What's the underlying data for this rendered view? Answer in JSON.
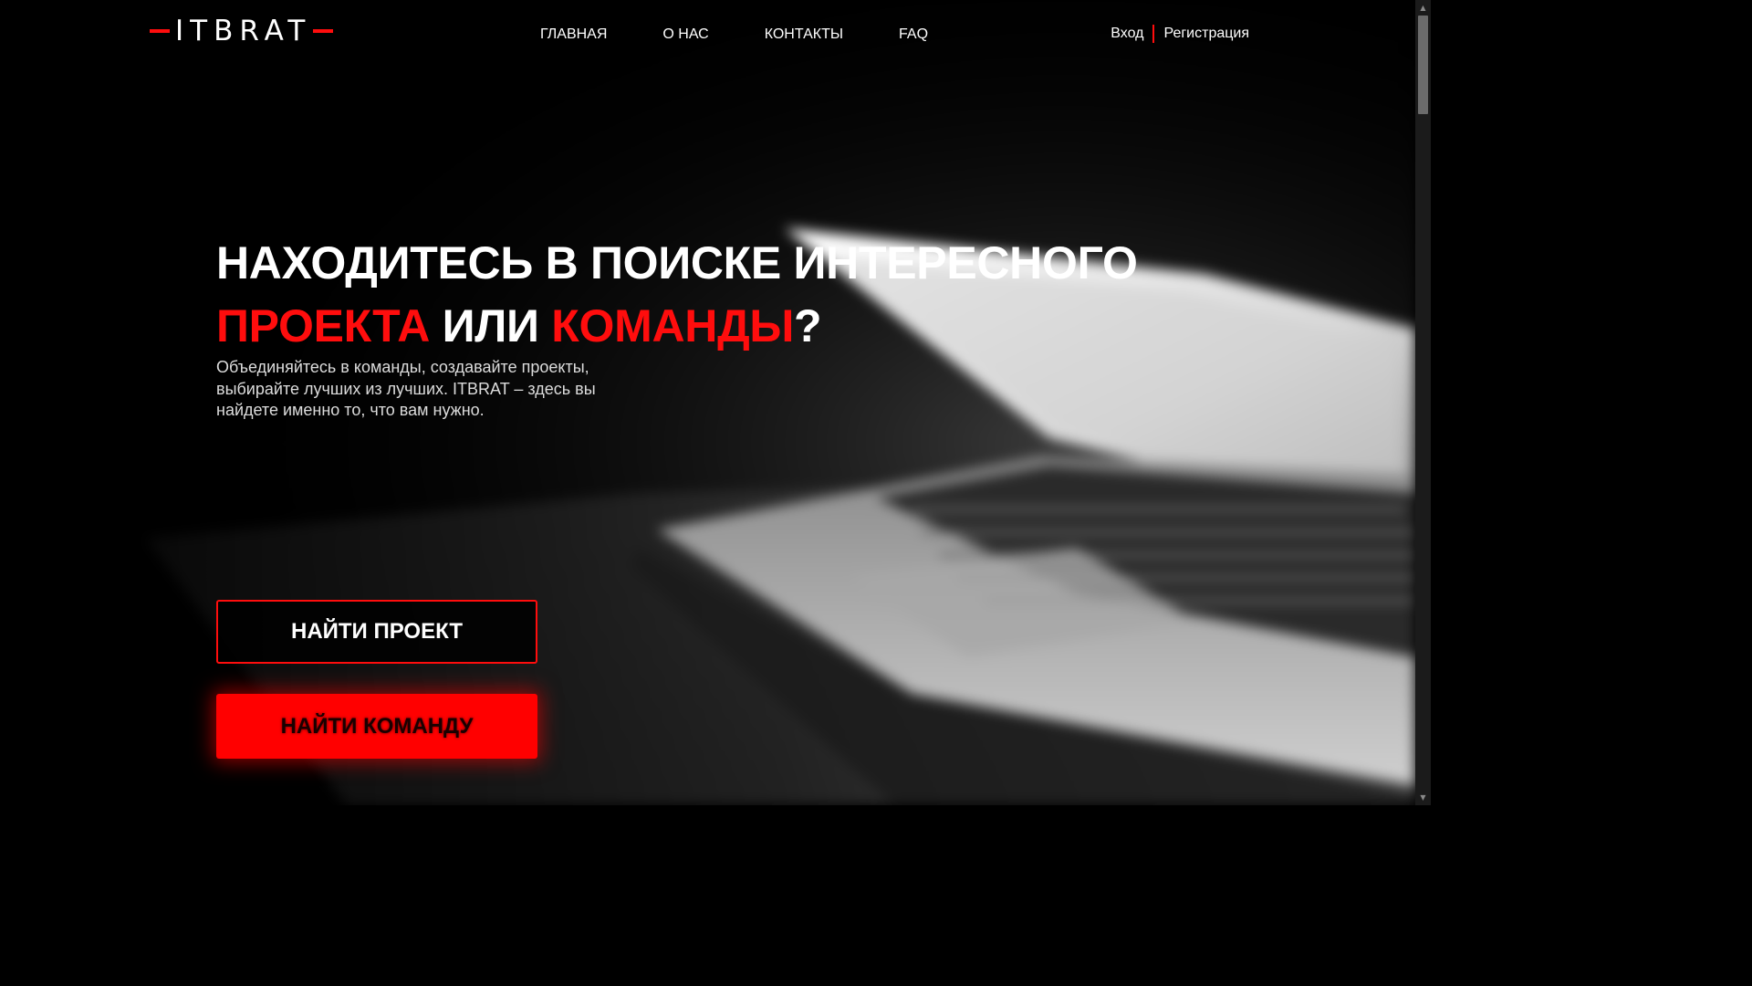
{
  "brand": {
    "logo_text": "ITBRAT",
    "accent_color": "#ff0d0d"
  },
  "nav": {
    "items": [
      {
        "label": "ГЛАВНАЯ"
      },
      {
        "label": "О НАС"
      },
      {
        "label": "КОНТАКТЫ"
      },
      {
        "label": "FAQ"
      }
    ]
  },
  "auth": {
    "login_label": "Вход",
    "register_label": "Регистрация"
  },
  "hero": {
    "title_part1": "НАХОДИТЕСЬ В ПОИСКЕ ИНТЕРЕСНОГО",
    "title_accent1": "ПРОЕКТА",
    "title_middle": " ИЛИ ",
    "title_accent2": "КОМАНДЫ",
    "title_end": "?",
    "subtitle": "Объединяйтесь в команды, создавайте проекты, выбирайте лучших из лучших. ITBRAT – здесь вы найдете именно то, что вам нужно.",
    "find_project_label": "НАЙТИ ПРОЕКТ",
    "find_team_label": "НАЙТИ КОМАНДУ"
  },
  "icons": {
    "scroll_up": "▲",
    "scroll_down": "▼"
  }
}
